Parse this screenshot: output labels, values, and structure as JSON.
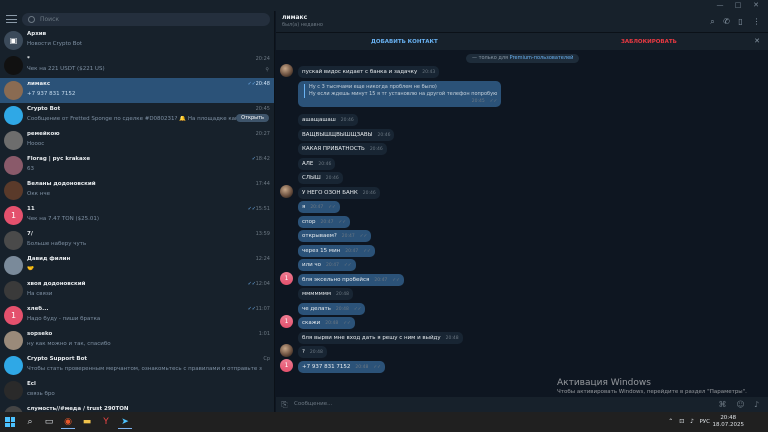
{
  "window": {
    "controls": [
      "—",
      "□",
      "✕"
    ]
  },
  "sidebar": {
    "search_placeholder": "Поиск",
    "archive": {
      "name": "Архив",
      "preview": "Новости Crypto Bot"
    },
    "chats": [
      {
        "name": "*",
        "preview": "Чек на 221 USDT ($221 US)",
        "time": "20:24",
        "pinned": true,
        "avatar_color": "#111111"
      },
      {
        "name": "лимакс",
        "preview": "+7 937 831 7152",
        "time": "20:48",
        "checks": "✓✓",
        "active": true,
        "avatar_color": "#8a6b52"
      },
      {
        "name": "Crypto Bot",
        "preview": "Сообщение от Fretted Sponge по сделке #D080231? 🔔 На площадке канала...",
        "time": "20:45",
        "button": "Открыть",
        "avatar_color": "#2fa8e6"
      },
      {
        "name": "ремейкою",
        "preview": "Нооос",
        "time": "20:27",
        "avatar_color": "#6d6d6d"
      },
      {
        "name": "Florag | рус krakaxe",
        "preview": "63",
        "time": "18:42",
        "checks": "✓",
        "avatar_color": "#8a5a6a"
      },
      {
        "name": "Веланы додоновский",
        "preview": "Окк нче",
        "time": "17:44",
        "avatar_color": "#5a3a2a"
      },
      {
        "name": "11",
        "preview": "Чек на 7.47 TON ($25.01)",
        "time": "15:51",
        "checks": "✓✓",
        "avatar_color": "#e4516d",
        "avatar_text": "1"
      },
      {
        "name": "7/",
        "preview": "Больше наберу чуть",
        "time": "13:59",
        "avatar_color": "#4a4a4a"
      },
      {
        "name": "Давид филин",
        "preview": "🤝",
        "time": "12:24",
        "avatar_color": "#7a8a9a"
      },
      {
        "name": "хвоя додоновский",
        "preview": "На связи",
        "time": "12:04",
        "checks": "✓✓",
        "avatar_color": "#3a3a3a"
      },
      {
        "name": "хлеб...",
        "preview": "Надо буду - пиши братка",
        "time": "11:07",
        "checks": "✓✓",
        "avatar_color": "#e4516d",
        "avatar_text": "1"
      },
      {
        "name": "sopseko",
        "preview": "ну как можно и так, спасибо",
        "time": "1:01",
        "avatar_color": "#9a8a7a"
      },
      {
        "name": "Crypto Support Bot",
        "preview": "Чтобы стать проверенным мерчантом, ознакомьтесь с правилами и отправьте заявку (тутела...",
        "time": "Ср",
        "avatar_color": "#2fa8e6"
      },
      {
        "name": "Ecl",
        "preview": "связь бро",
        "time": "",
        "avatar_color": "#2a2a2a"
      },
      {
        "name": "слумость//#меда / trust 290TON",
        "preview": "",
        "time": "",
        "avatar_color": "#444444"
      }
    ]
  },
  "header": {
    "name": "лимакс",
    "status": "был(а) недавно",
    "add_contact": "ДОБАВИТЬ КОНТАКТ",
    "block": "ЗАБЛОКИРОВАТЬ",
    "notice_prefix": "— только для",
    "notice_link": "Premium-пользователей"
  },
  "messages": [
    {
      "text": "пускай видос кидает с банка и задачку",
      "time": "20:43",
      "avatar": "photo"
    },
    {
      "text": "Ну с 3 тысячами еще никогда проблем не было)\nНу если ждешь минут 15 я тг установлю на другой телефон попробую",
      "time": "20:45",
      "own": true,
      "quote": true
    },
    {
      "text": "ашащашаш",
      "time": "20:46"
    },
    {
      "text": "ВАЩВЫШЩВЫШЩЗАВЫ",
      "time": "20:46"
    },
    {
      "text": "КАКАЯ ПРИВАТНОСТЬ",
      "time": "20:46"
    },
    {
      "text": "АЛЕ",
      "time": "20:46"
    },
    {
      "text": "СЛЫШ",
      "time": "20:46"
    },
    {
      "text": "У НЕГО ОЗОН БАНК",
      "time": "20:46",
      "avatar": "photo"
    },
    {
      "text": "я",
      "time": "20:47",
      "own": true
    },
    {
      "text": "спор",
      "time": "20:47",
      "own": true
    },
    {
      "text": "открываем?",
      "time": "20:47",
      "own": true
    },
    {
      "text": "через 15 мин",
      "time": "20:47",
      "own": true
    },
    {
      "text": "или чо",
      "time": "20:47",
      "own": true
    },
    {
      "text": "бля эксельно пробейся",
      "time": "20:47",
      "own": true,
      "avatar": "pink"
    },
    {
      "text": "ммммммм",
      "time": "20:48"
    },
    {
      "text": "че делать",
      "time": "20:48",
      "own": true
    },
    {
      "text": "скажи",
      "time": "20:48",
      "own": true,
      "avatar": "pink"
    },
    {
      "text": "бля вырви мне вход дать я решу с ним и выйду",
      "time": "20:48"
    },
    {
      "text": "?",
      "time": "20:48",
      "avatar": "photo"
    },
    {
      "text": "+7 937 831 7152",
      "time": "20:48",
      "own": true,
      "avatar": "pink"
    }
  ],
  "composer": {
    "placeholder": "Сообщение..."
  },
  "activation": {
    "title": "Активация Windows",
    "subtitle": "Чтобы активировать Windows, перейдите в раздел \"Параметры\"."
  },
  "taskbar": {
    "lang": "РУС",
    "time": "20:48",
    "date": "18.07.2025"
  }
}
